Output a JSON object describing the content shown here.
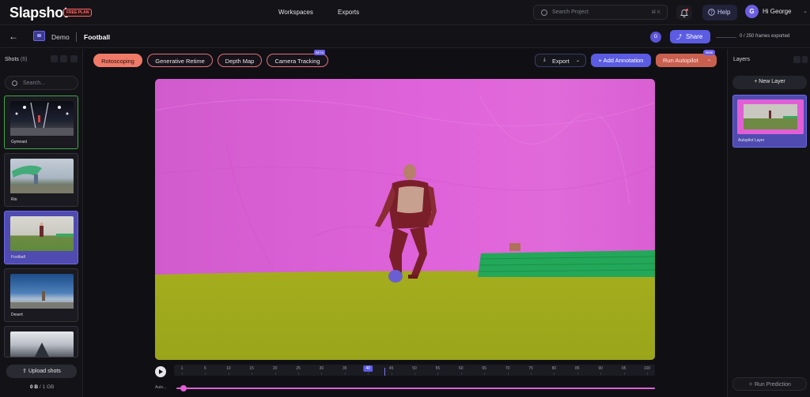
{
  "app": {
    "name": "Slapshot",
    "plan_badge": "FREE PLAN"
  },
  "nav": {
    "workspaces": "Workspaces",
    "exports": "Exports"
  },
  "search": {
    "placeholder": "Search Project",
    "shortcut": "⌘ K"
  },
  "help": {
    "label": "Help"
  },
  "user": {
    "initial": "G",
    "greeting": "Hi George"
  },
  "breadcrumb": {
    "project": "Demo",
    "shot": "Football"
  },
  "share": {
    "avatar_initial": "G",
    "label": "Share",
    "frames_exported": "0 / 250 frames exported"
  },
  "shots_panel": {
    "title": "Shots",
    "count": "(6)",
    "search_placeholder": "Search...",
    "items": [
      {
        "label": "Gymnast"
      },
      {
        "label": "Rio"
      },
      {
        "label": "Football"
      },
      {
        "label": "Desert"
      },
      {
        "label": ""
      }
    ],
    "upload_label": "Upload shots",
    "storage_used": "0 B",
    "storage_total": " / 1 GB"
  },
  "tools": {
    "rotoscoping": "Rotoscoping",
    "generative_retime": "Generative Retime",
    "depth_map": "Depth Map",
    "camera_tracking": "Camera Tracking",
    "camera_tracking_badge": "BETA"
  },
  "actions": {
    "export": "Export",
    "add_annotation": "+ Add Annotation",
    "run_autopilot": "Run Autopilot",
    "autopilot_badge": "New"
  },
  "timeline": {
    "ticks": [
      "1",
      "5",
      "10",
      "15",
      "20",
      "25",
      "30",
      "35",
      "40",
      "45",
      "50",
      "55",
      "60",
      "65",
      "70",
      "75",
      "80",
      "85",
      "90",
      "95",
      "100"
    ],
    "current_frame": "40",
    "track_label": "Auto..."
  },
  "layers_panel": {
    "title": "Layers",
    "new_layer": "+ New Layer",
    "items": [
      {
        "label": "Autopilot Layer"
      }
    ],
    "run_prediction": "Run Prediction"
  },
  "colors": {
    "accent": "#5b5ce2",
    "mask_pink": "#dc5fd8",
    "mask_yellow": "#a9b31e",
    "mask_green": "#23a85a",
    "mask_maroon": "#7a1f2a"
  }
}
